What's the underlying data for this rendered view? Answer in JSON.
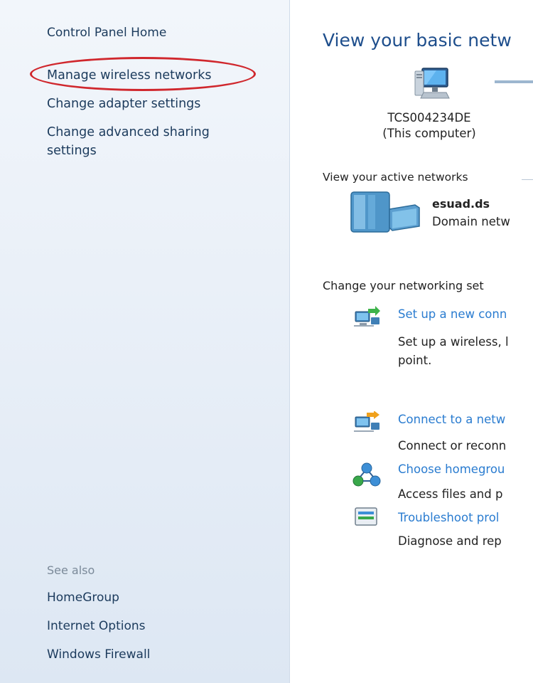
{
  "sidebar": {
    "home": "Control Panel Home",
    "links": [
      "Manage wireless networks",
      "Change adapter settings",
      "Change advanced sharing",
      "settings"
    ],
    "see_also_heading": "See also",
    "see_also": [
      "HomeGroup",
      "Internet Options",
      "Windows Firewall"
    ]
  },
  "main": {
    "title": "View your basic netw",
    "computer": {
      "name": "TCS004234DE",
      "subtitle": "(This computer)"
    },
    "active_networks_label": "View your active networks",
    "network": {
      "name": "esuad.ds",
      "type": "Domain netw"
    },
    "change_settings_label": "Change your networking set",
    "tasks": [
      {
        "title": "Set up a new conn",
        "desc_line1": "Set up a wireless, l",
        "desc_line2": "point."
      },
      {
        "title": "Connect to a netw",
        "desc_line1": "Connect or reconn"
      },
      {
        "title": "Choose homegrou",
        "desc_line1": "Access files and p"
      },
      {
        "title": "Troubleshoot prol",
        "desc_line1": "Diagnose and rep"
      }
    ]
  },
  "colors": {
    "link": "#2a7cd0",
    "title": "#1e4e8c",
    "sidebar_text": "#1b3a5c",
    "highlight": "#d0272d"
  }
}
